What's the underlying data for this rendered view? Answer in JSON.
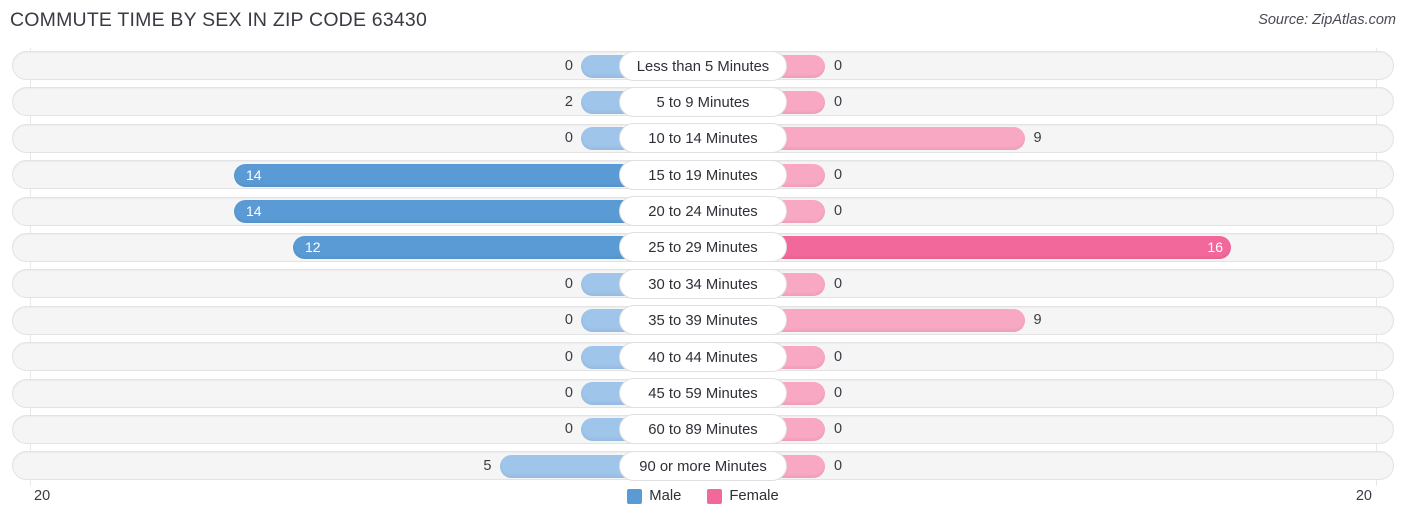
{
  "header": {
    "title": "COMMUTE TIME BY SEX IN ZIP CODE 63430",
    "source": "Source: ZipAtlas.com"
  },
  "legend": {
    "male_label": "Male",
    "female_label": "Female",
    "male_color": "#5b9bd5",
    "female_color": "#f2689a"
  },
  "axis": {
    "left_max": "20",
    "right_max": "20"
  },
  "chart_data": {
    "type": "bar",
    "title": "COMMUTE TIME BY SEX IN ZIP CODE 63430",
    "orientation": "horizontal-diverging",
    "xlabel": "",
    "ylabel": "",
    "xlim": [
      20,
      20
    ],
    "grid": false,
    "legend_position": "bottom-center",
    "categories": [
      "Less than 5 Minutes",
      "5 to 9 Minutes",
      "10 to 14 Minutes",
      "15 to 19 Minutes",
      "20 to 24 Minutes",
      "25 to 29 Minutes",
      "30 to 34 Minutes",
      "35 to 39 Minutes",
      "40 to 44 Minutes",
      "45 to 59 Minutes",
      "60 to 89 Minutes",
      "90 or more Minutes"
    ],
    "series": [
      {
        "name": "Male",
        "values": [
          0,
          2,
          0,
          14,
          14,
          12,
          0,
          0,
          0,
          0,
          0,
          5
        ]
      },
      {
        "name": "Female",
        "values": [
          0,
          0,
          9,
          0,
          0,
          16,
          0,
          9,
          0,
          0,
          0,
          0
        ]
      }
    ],
    "value_labels": {
      "male": [
        "0",
        "2",
        "0",
        "14",
        "14",
        "12",
        "0",
        "0",
        "0",
        "0",
        "0",
        "5"
      ],
      "female": [
        "0",
        "0",
        "9",
        "0",
        "0",
        "16",
        "0",
        "9",
        "0",
        "0",
        "0",
        "0"
      ]
    }
  }
}
